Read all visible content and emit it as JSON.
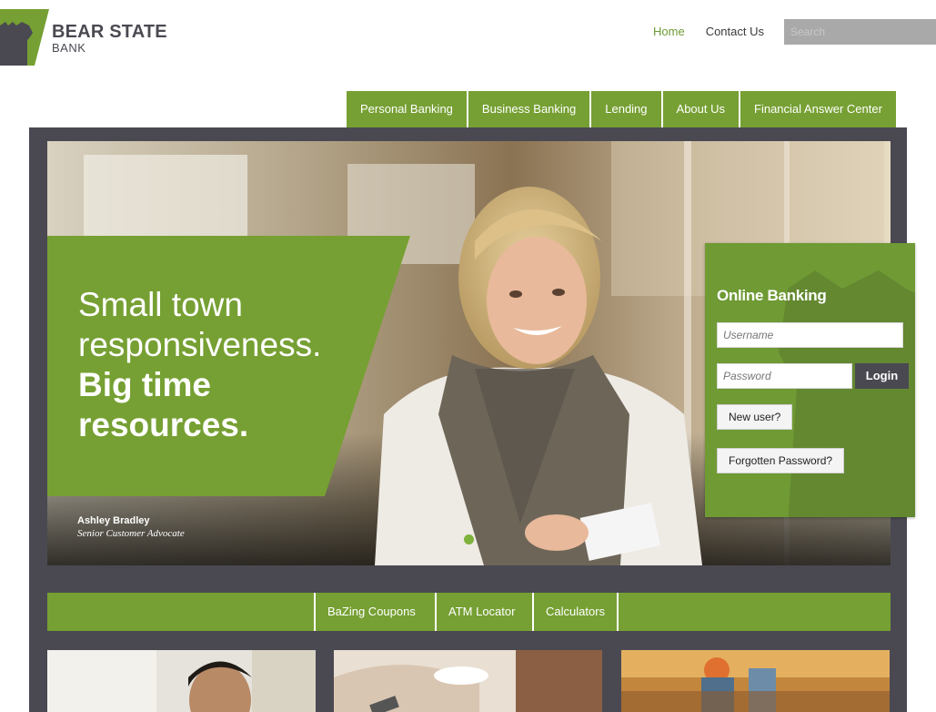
{
  "brand": {
    "name": "BEAR STATE",
    "sub": "BANK",
    "logo_icon": "bear-head-icon",
    "colors": {
      "green": "#76a033",
      "dark": "#4a4952",
      "active_link": "#6c9a32"
    }
  },
  "top_links": [
    {
      "label": "Home",
      "active": true
    },
    {
      "label": "Contact Us",
      "active": false
    }
  ],
  "search": {
    "placeholder": "Search",
    "value": ""
  },
  "main_nav": [
    "Personal Banking",
    "Business Banking",
    "Lending",
    "About Us",
    "Financial Answer Center"
  ],
  "hero": {
    "headline_light_1": "Small town",
    "headline_light_2": "responsiveness.",
    "headline_bold_1": "Big time",
    "headline_bold_2": "resources.",
    "person_name": "Ashley Bradley",
    "person_role": "Senior Customer Advocate",
    "slide_indicator": "slide-dot"
  },
  "login": {
    "title": "Online Banking",
    "username_placeholder": "Username",
    "password_placeholder": "Password",
    "login_label": "Login",
    "new_user_label": "New user?",
    "forgot_label": "Forgotten Password?"
  },
  "sub_nav": [
    "BaZing Coupons",
    "ATM Locator",
    "Calculators"
  ]
}
